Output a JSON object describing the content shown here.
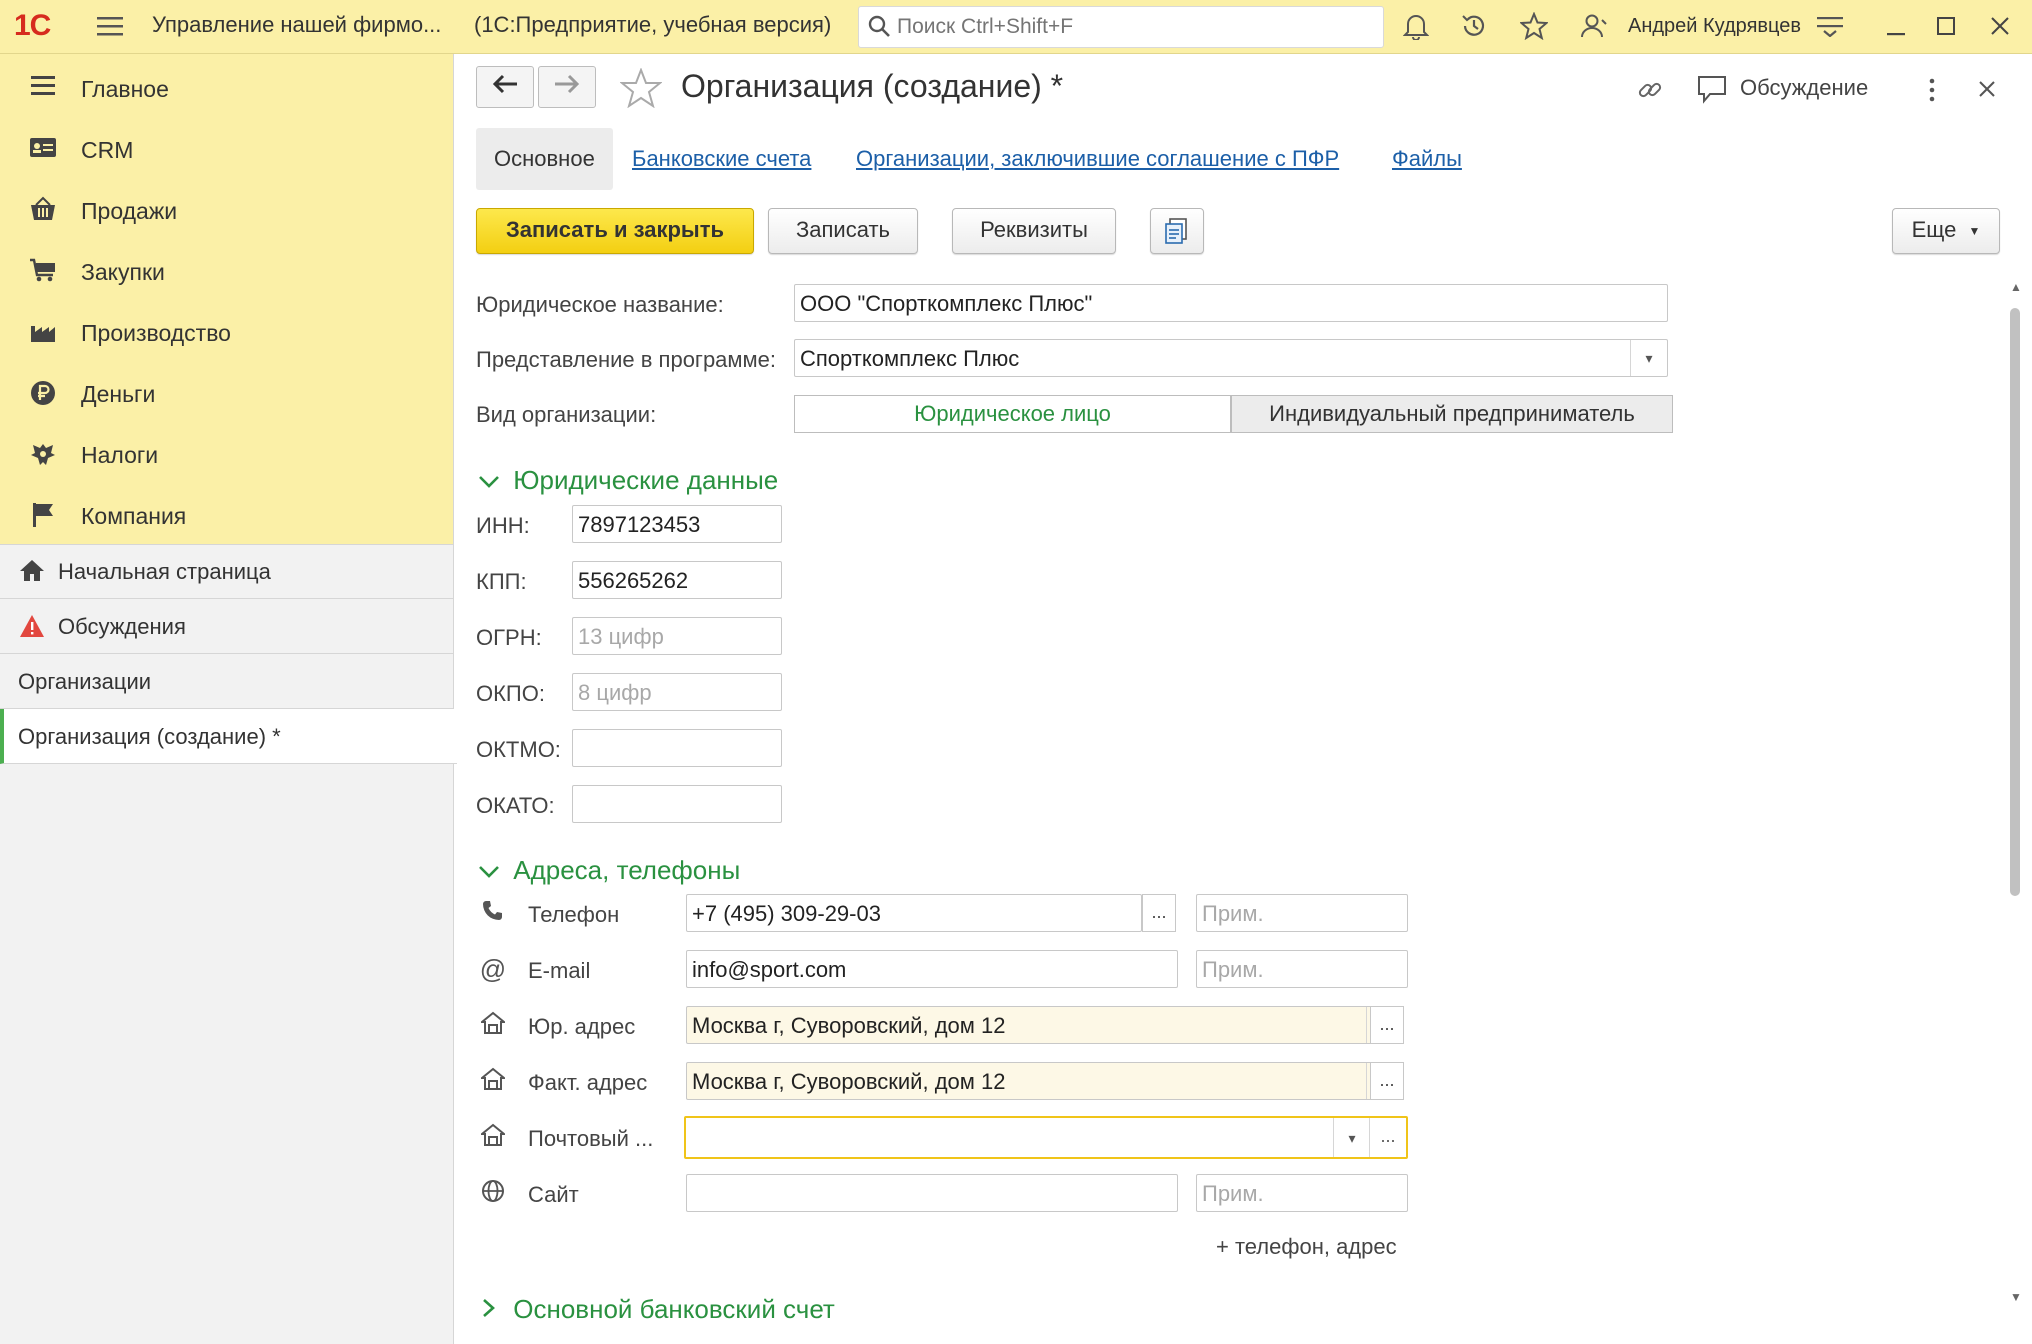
{
  "titlebar": {
    "logo": "1С",
    "app_title": "Управление нашей фирмо...",
    "platform": "(1С:Предприятие, учебная версия)",
    "search_placeholder": "Поиск Ctrl+Shift+F",
    "user": "Андрей Кудрявцев"
  },
  "sections": [
    {
      "label": "Главное",
      "icon": "menu-icon"
    },
    {
      "label": "CRM",
      "icon": "crm-card-icon"
    },
    {
      "label": "Продажи",
      "icon": "basket-icon"
    },
    {
      "label": "Закупки",
      "icon": "cart-icon"
    },
    {
      "label": "Производство",
      "icon": "factory-icon"
    },
    {
      "label": "Деньги",
      "icon": "ruble-icon"
    },
    {
      "label": "Налоги",
      "icon": "eagle-icon"
    },
    {
      "label": "Компания",
      "icon": "flag-icon"
    }
  ],
  "open_windows": [
    {
      "label": "Начальная страница",
      "icon": "home-icon"
    },
    {
      "label": "Обсуждения",
      "icon": "warning-icon"
    },
    {
      "label": "Организации"
    },
    {
      "label": "Организация (создание) *"
    }
  ],
  "form": {
    "title": "Организация (создание) *",
    "discussion": "Обсуждение",
    "tabs": [
      "Основное",
      "Банковские счета",
      "Организации, заключившие соглашение с ПФР",
      "Файлы"
    ],
    "buttons": {
      "save_close": "Записать и закрыть",
      "save": "Записать",
      "requisites": "Реквизиты",
      "more": "Еще"
    },
    "legal_name_label": "Юридическое название:",
    "legal_name": "ООО \"Спорткомплекс Плюс\"",
    "presentation_label": "Представление в программе:",
    "presentation": "Спорткомплекс Плюс",
    "org_type_label": "Вид организации:",
    "org_type_options": [
      "Юридическое лицо",
      "Индивидуальный предприниматель"
    ],
    "legal_group": "Юридические данные",
    "inn_label": "ИНН:",
    "inn": "7897123453",
    "kpp_label": "КПП:",
    "kpp": "556265262",
    "ogrn_label": "ОГРН:",
    "ogrn_placeholder": "13 цифр",
    "okpo_label": "ОКПО:",
    "okpo_placeholder": "8 цифр",
    "oktmo_label": "ОКТМО:",
    "okato_label": "ОКАТО:",
    "contacts_group": "Адреса, телефоны",
    "phone_label": "Телефон",
    "phone": "+7 (495) 309-29-03",
    "note_placeholder": "Прим.",
    "email_label": "E-mail",
    "email": "info@sport.com",
    "legal_address_label": "Юр. адрес",
    "legal_address": "Москва г, Суворовский, дом 12",
    "actual_address_label": "Факт. адрес",
    "actual_address": "Москва г, Суворовский, дом 12",
    "postal_label": "Почтовый ...",
    "site_label": "Сайт",
    "add_contact": "+ телефон, адрес",
    "bank_group": "Основной банковский счет"
  },
  "colors": {
    "titlebar_bg": "#fbf0a7",
    "accent_green": "#2a9140",
    "link_blue": "#1c5fa8",
    "primary_button": "#f3cf12"
  }
}
